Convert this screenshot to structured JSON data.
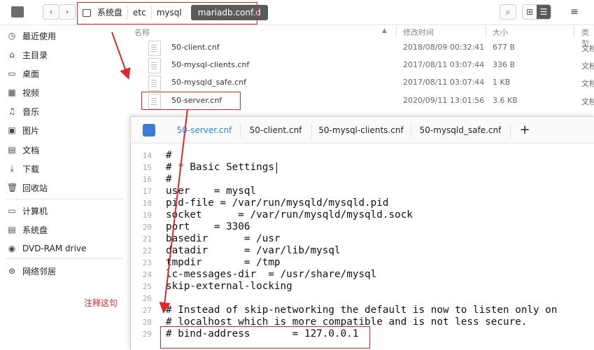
{
  "breadcrumbs": [
    "系统盘",
    "etc",
    "mysql",
    "mariadb.conf.d"
  ],
  "toolbar": {
    "back": "‹",
    "forward": "›"
  },
  "sidebar": {
    "items": [
      {
        "label": "最近使用",
        "icon": "clock-icon"
      },
      {
        "label": "主目录",
        "icon": "home-icon"
      },
      {
        "label": "桌面",
        "icon": "desktop-icon"
      },
      {
        "label": "视频",
        "icon": "video-icon"
      },
      {
        "label": "音乐",
        "icon": "music-icon"
      },
      {
        "label": "图片",
        "icon": "picture-icon"
      },
      {
        "label": "文档",
        "icon": "document-icon"
      },
      {
        "label": "下载",
        "icon": "download-icon"
      },
      {
        "label": "回收站",
        "icon": "trash-icon"
      },
      {
        "label": "计算机",
        "icon": "computer-icon"
      },
      {
        "label": "系统盘",
        "icon": "disk-icon"
      },
      {
        "label": "DVD-RAM drive",
        "icon": "dvd-icon"
      },
      {
        "label": "网络邻居",
        "icon": "network-icon"
      }
    ]
  },
  "file_list": {
    "headers": {
      "name": "名称",
      "modified": "修改时间",
      "size": "大小",
      "type": "类型"
    },
    "rows": [
      {
        "name": "50-client.cnf",
        "modified": "2018/08/09 00:32:41",
        "size": "677 B",
        "type": "文档"
      },
      {
        "name": "50-mysql-clients.cnf",
        "modified": "2017/08/11 03:07:44",
        "size": "336 B",
        "type": "文档"
      },
      {
        "name": "50-mysqld_safe.cnf",
        "modified": "2017/08/11 03:07:44",
        "size": "1 KB",
        "type": "文档"
      },
      {
        "name": "50-server.cnf",
        "modified": "2020/09/11 13:01:56",
        "size": "3.6 KB",
        "type": "文档"
      }
    ]
  },
  "editor": {
    "tabs": [
      "50-server.cnf",
      "50-client.cnf",
      "50-mysql-clients.cnf",
      "50-mysqld_safe.cnf"
    ],
    "add_tab": "+",
    "lines": [
      {
        "n": "14",
        "t": "#"
      },
      {
        "n": "15",
        "t": "# * Basic Settings"
      },
      {
        "n": "16",
        "t": "#"
      },
      {
        "n": "17",
        "t": "user    = mysql"
      },
      {
        "n": "18",
        "t": "pid-file = /var/run/mysqld/mysqld.pid"
      },
      {
        "n": "19",
        "t": "socket      = /var/run/mysqld/mysqld.sock"
      },
      {
        "n": "20",
        "t": "port    = 3306"
      },
      {
        "n": "21",
        "t": "basedir      = /usr"
      },
      {
        "n": "22",
        "t": "datadir      = /var/lib/mysql"
      },
      {
        "n": "23",
        "t": "tmpdir       = /tmp"
      },
      {
        "n": "24",
        "t": "lc-messages-dir  = /usr/share/mysql"
      },
      {
        "n": "25",
        "t": "skip-external-locking"
      },
      {
        "n": "26",
        "t": ""
      },
      {
        "n": "27",
        "t": "# Instead of skip-networking the default is now to listen only on"
      },
      {
        "n": "28",
        "t": "# localhost which is more compatible and is not less secure."
      },
      {
        "n": "29",
        "t": "# bind-address       = 127.0.0.1"
      }
    ]
  },
  "annotation": {
    "note": "注释这句",
    "color": "#e0262b"
  },
  "colors": {
    "accent": "#2b86e8",
    "crumb_active_bg": "#5a5a5a"
  }
}
